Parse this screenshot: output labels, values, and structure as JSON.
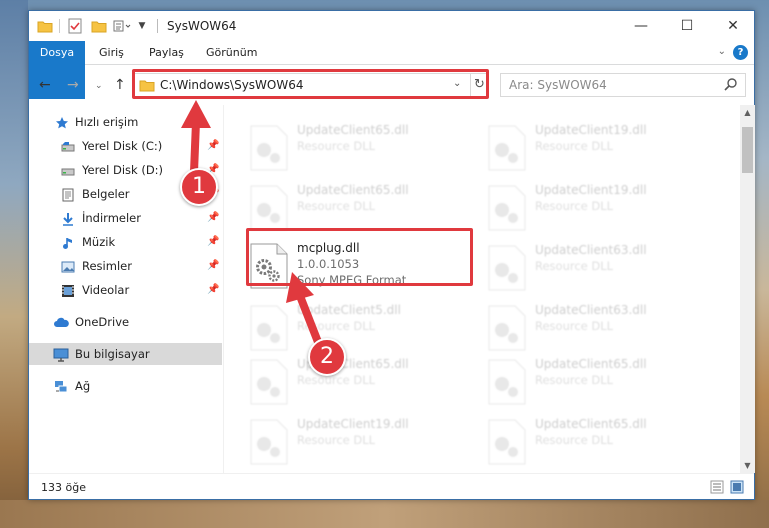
{
  "window": {
    "title": "SysWOW64"
  },
  "ribbon": {
    "tabs": [
      "Dosya",
      "Giriş",
      "Paylaş",
      "Görünüm"
    ]
  },
  "nav": {
    "address": "C:\\Windows\\SysWOW64",
    "search_placeholder": "Ara: SysWOW64"
  },
  "sidebar": {
    "items": [
      {
        "label": "Hızlı erişim",
        "icon": "star-icon"
      },
      {
        "label": "Yerel Disk (C:)",
        "icon": "drive-icon",
        "pinned": true
      },
      {
        "label": "Yerel Disk (D:)",
        "icon": "drive-icon",
        "pinned": true
      },
      {
        "label": "Belgeler",
        "icon": "documents-icon",
        "pinned": true
      },
      {
        "label": "İndirmeler",
        "icon": "download-icon",
        "pinned": true
      },
      {
        "label": "Müzik",
        "icon": "music-icon",
        "pinned": true
      },
      {
        "label": "Resimler",
        "icon": "pictures-icon",
        "pinned": true
      },
      {
        "label": "Videolar",
        "icon": "videos-icon",
        "pinned": true
      },
      {
        "label": "OneDrive",
        "icon": "cloud-icon"
      },
      {
        "label": "Bu bilgisayar",
        "icon": "computer-icon",
        "selected": true
      },
      {
        "label": "Ağ",
        "icon": "network-icon"
      }
    ]
  },
  "files": {
    "left_column": [
      {
        "name": "UpdateClient65.dll",
        "desc": "Resource DLL"
      },
      {
        "name": "UpdateClient65.dll",
        "desc": "Resource DLL"
      },
      {
        "name": "mcplug.dll",
        "version": "1.0.0.1053",
        "desc": "Sony MPEG Format"
      },
      {
        "name": "UpdateClient5.dll",
        "desc": "Resource DLL"
      },
      {
        "name": "UpdateClient65.dll",
        "desc": "Resource DLL"
      },
      {
        "name": "UpdateClient19.dll",
        "desc": "Resource DLL"
      }
    ],
    "right_column": [
      {
        "name": "UpdateClient19.dll",
        "desc": "Resource DLL"
      },
      {
        "name": "UpdateClient19.dll",
        "desc": "Resource DLL"
      },
      {
        "name": "UpdateClient63.dll",
        "desc": "Resource DLL"
      },
      {
        "name": "UpdateClient63.dll",
        "desc": "Resource DLL"
      },
      {
        "name": "UpdateClient65.dll",
        "desc": "Resource DLL"
      },
      {
        "name": "UpdateClient65.dll",
        "desc": "Resource DLL"
      }
    ]
  },
  "status": {
    "count": "133 öğe"
  },
  "annotations": {
    "badge1": "1",
    "badge2": "2"
  },
  "colors": {
    "highlight": "#e0393e",
    "accent": "#1979ca",
    "selected": "#d9d9d9"
  }
}
